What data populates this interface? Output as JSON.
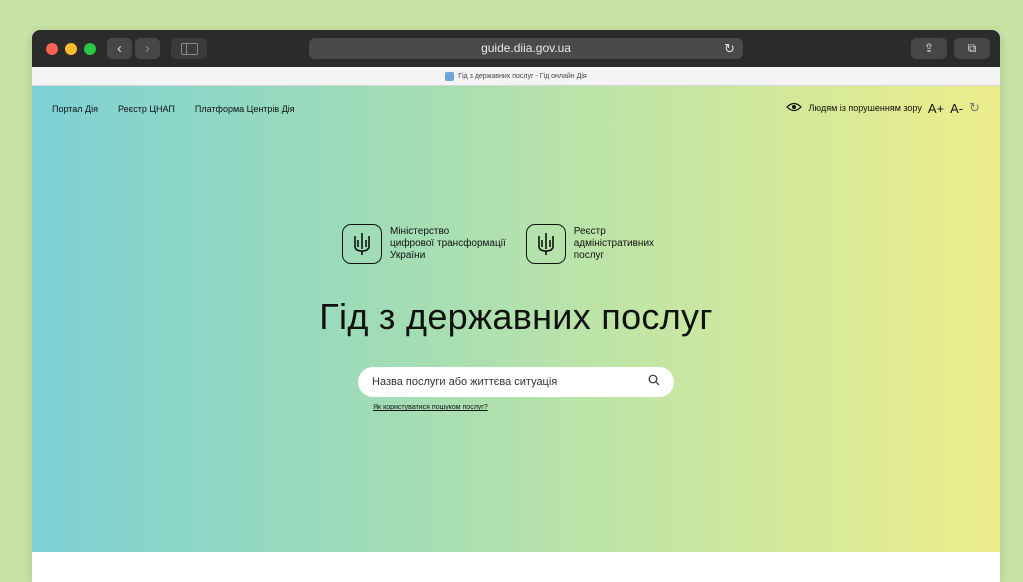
{
  "browser": {
    "url": "guide.diia.gov.ua",
    "tab_title": "Гід з державних послуг - Гід онлайн Дія"
  },
  "site": {
    "nav": [
      {
        "label": "Портал Дія"
      },
      {
        "label": "Реєстр ЦНАП"
      },
      {
        "label": "Платформа Центрів Дія"
      }
    ],
    "accessibility_label": "Людям із порушенням зору",
    "font_increase": "A+",
    "font_decrease": "A-",
    "logos": [
      {
        "text": [
          "Міністерство",
          "цифрової трансформації",
          "України"
        ]
      },
      {
        "text": [
          "Реєстр",
          "адміністративних",
          "послуг"
        ]
      }
    ],
    "title": "Гід з державних послуг",
    "search_placeholder": "Назва послуги або життєва ситуація",
    "help_link": "Як користуватися пошуком послуг?"
  },
  "colors": {
    "gradient_left": "#7dd1d6",
    "gradient_right": "#eded8a"
  }
}
